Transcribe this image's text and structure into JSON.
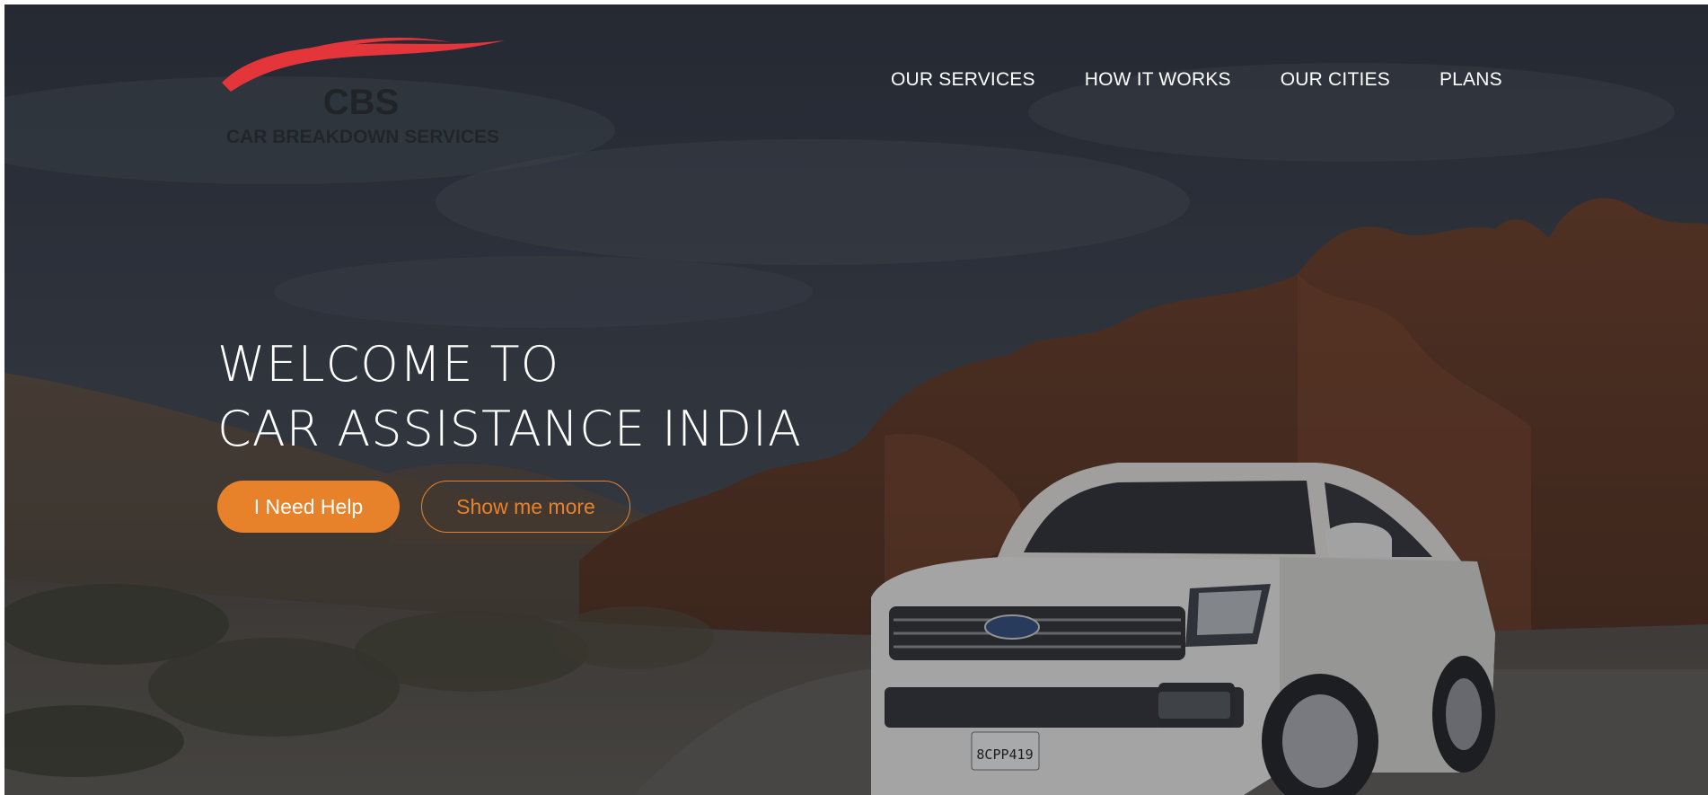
{
  "brand": {
    "logo_letters": "CBS",
    "logo_tagline": "CAR BREAKDOWN SERVICES",
    "accent_color": "#e8822a",
    "logo_swoosh_color": "#e3353a"
  },
  "nav": {
    "items": [
      {
        "label": "OUR SERVICES"
      },
      {
        "label": "HOW IT WORKS"
      },
      {
        "label": "OUR CITIES"
      },
      {
        "label": "PLANS"
      }
    ]
  },
  "hero": {
    "headline_line1": "WELCOME TO",
    "headline_line2": "CAR ASSISTANCE INDIA",
    "primary_button": "I Need Help",
    "secondary_button": "Show me more",
    "license_plate": "8CPP419"
  }
}
